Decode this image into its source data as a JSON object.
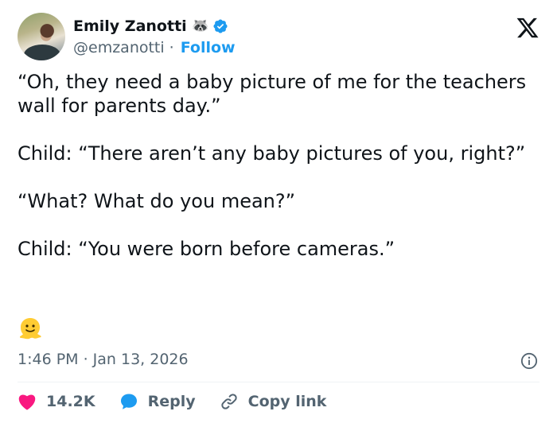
{
  "author": {
    "name": "Emily Zanotti",
    "name_emoji": "🦝",
    "handle": "@emzanotti",
    "separator": "·",
    "follow_label": "Follow"
  },
  "tweet": {
    "paragraphs": [
      "“Oh, they need a baby picture of me for the teachers wall for parents day.”",
      "Child: “There aren’t any baby pictures of you, right?”",
      "“What? What do you mean?”",
      "Child: “You were born before cameras.”"
    ],
    "emoji": "melting-face",
    "timestamp": "1:46 PM · Jan 13, 2026"
  },
  "actions": {
    "like_count": "14.2K",
    "reply_label": "Reply",
    "copy_link_label": "Copy link"
  },
  "colors": {
    "text": "#0f1419",
    "secondary": "#536471",
    "accent": "#1d9bf0",
    "like": "#f91880"
  }
}
